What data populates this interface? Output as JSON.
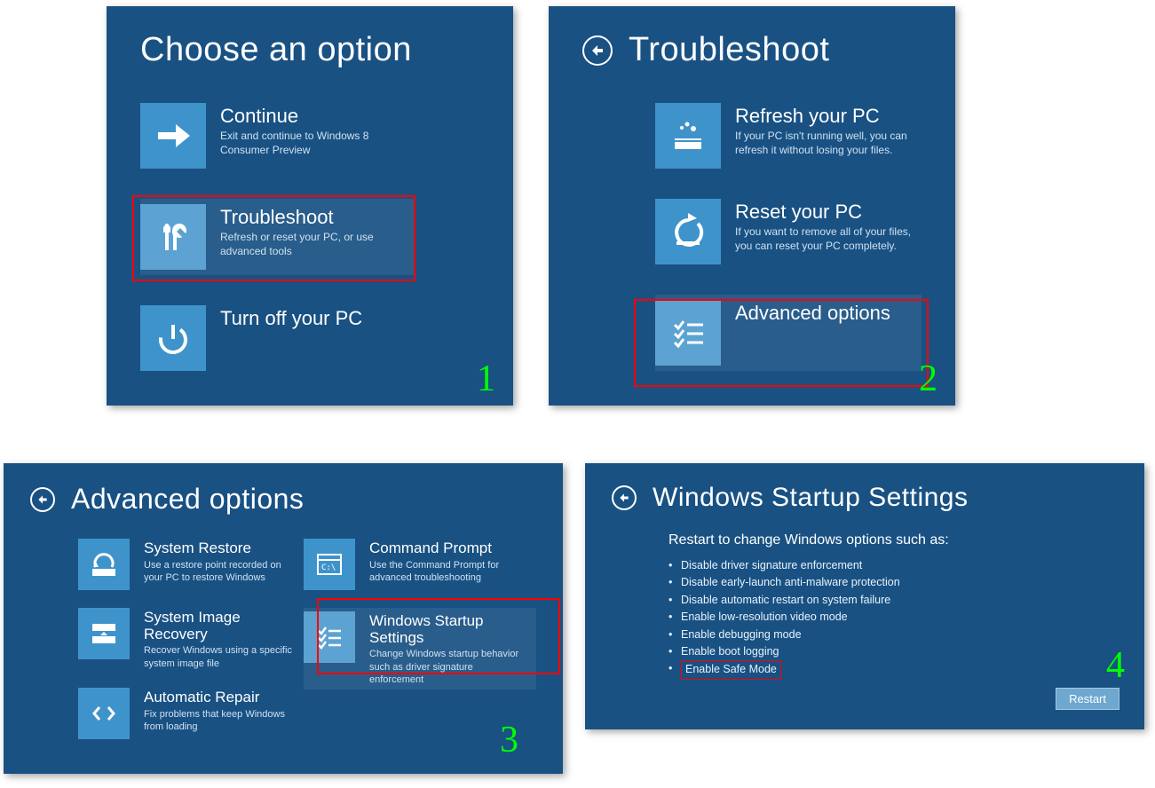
{
  "panel1": {
    "title": "Choose an option",
    "tiles": [
      {
        "title": "Continue",
        "desc": "Exit and continue to Windows 8 Consumer Preview"
      },
      {
        "title": "Troubleshoot",
        "desc": "Refresh or reset your PC, or use advanced tools"
      },
      {
        "title": "Turn off your PC",
        "desc": ""
      }
    ],
    "step": "1"
  },
  "panel2": {
    "title": "Troubleshoot",
    "tiles": [
      {
        "title": "Refresh your PC",
        "desc": "If your PC isn't running well, you can refresh it without losing your files."
      },
      {
        "title": "Reset your PC",
        "desc": "If you want to remove all of your files, you can reset your PC completely."
      },
      {
        "title": "Advanced options",
        "desc": ""
      }
    ],
    "step": "2"
  },
  "panel3": {
    "title": "Advanced options",
    "left": [
      {
        "title": "System Restore",
        "desc": "Use a restore point recorded on your PC to restore Windows"
      },
      {
        "title": "System Image Recovery",
        "desc": "Recover Windows using a specific system image file"
      },
      {
        "title": "Automatic Repair",
        "desc": "Fix problems that keep Windows from loading"
      }
    ],
    "right": [
      {
        "title": "Command Prompt",
        "desc": "Use the Command Prompt for advanced troubleshooting"
      },
      {
        "title": "Windows Startup Settings",
        "desc": "Change Windows startup behavior such as driver signature enforcement"
      }
    ],
    "step": "3"
  },
  "panel4": {
    "title": "Windows Startup Settings",
    "subtitle": "Restart to change Windows options such as:",
    "bullets": [
      "Disable driver signature enforcement",
      "Disable early-launch anti-malware protection",
      "Disable automatic restart on system failure",
      "Enable low-resolution video mode",
      "Enable debugging mode",
      "Enable boot logging",
      "Enable Safe Mode"
    ],
    "restart": "Restart",
    "step": "4"
  }
}
